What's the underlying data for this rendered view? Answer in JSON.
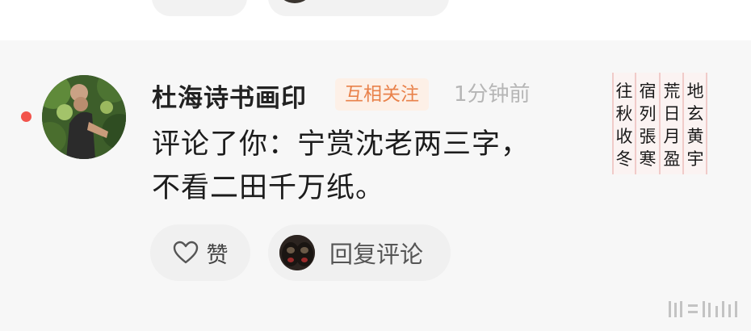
{
  "comment": {
    "username": "杜海诗书画印",
    "relation_badge": "互相关注",
    "timestamp": "1分钟前",
    "text": "评论了你：宁赏沈老两三字，不看二田千万纸。",
    "unread": true
  },
  "actions": {
    "like_label": "赞",
    "reply_label": "回复评论"
  },
  "thumbnail": {
    "columns": [
      [
        "往",
        "秋",
        "收",
        "冬"
      ],
      [
        "宿",
        "列",
        "張",
        "寒"
      ],
      [
        "荒",
        "日",
        "月",
        "盈"
      ],
      [
        "地",
        "玄",
        "黄",
        "宇"
      ]
    ]
  },
  "watermark": {
    "description": "faint grey logo watermark"
  },
  "colors": {
    "unread_dot": "#f2544c",
    "badge_text": "#e9824b",
    "badge_bg": "#fdf0e7",
    "timestamp": "#b6b6b6"
  },
  "icons": [
    "heart-icon"
  ]
}
